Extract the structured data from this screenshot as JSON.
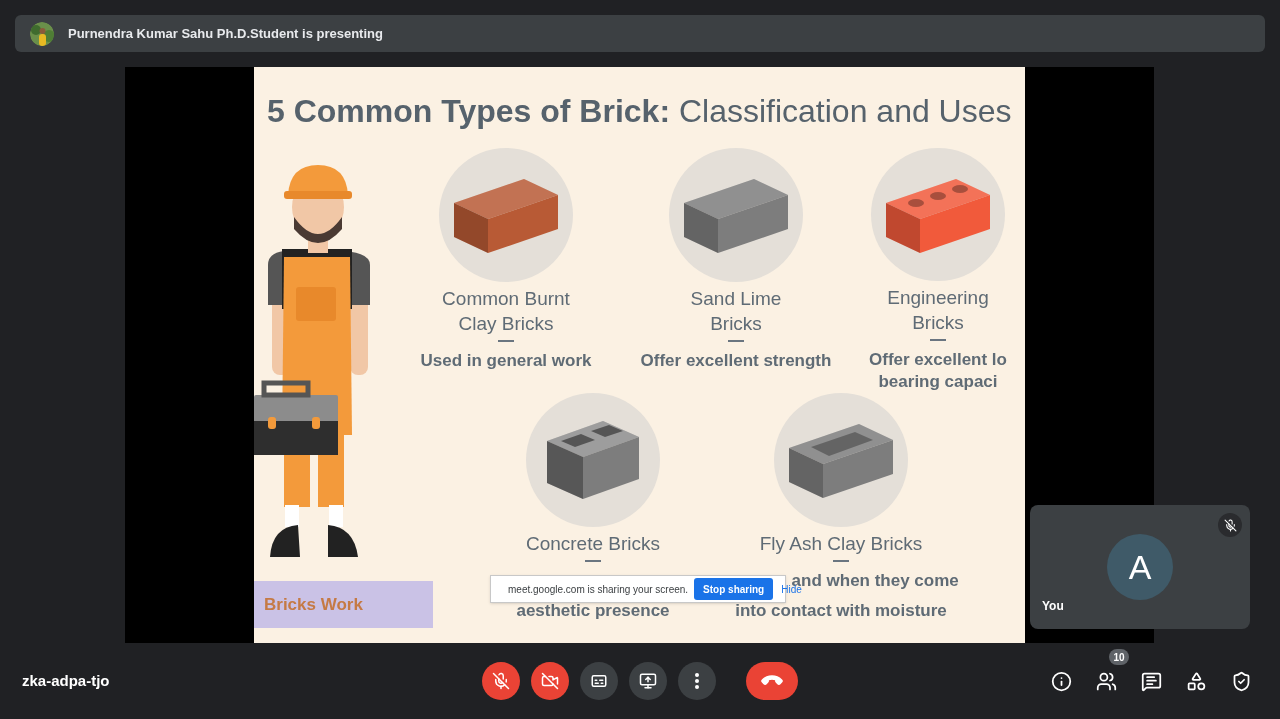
{
  "presenter_bar": {
    "text": "Purnendra Kumar Sahu Ph.D.Student is presenting"
  },
  "slide": {
    "title": "**5 Common Types of Brick:** Classification and Uses",
    "bricks": [
      {
        "kind": "solid",
        "color": "#b85a35",
        "name_lines": [
          "Common Burnt",
          "Clay Bricks"
        ],
        "desc_lines": [
          "Used in general work"
        ]
      },
      {
        "kind": "solid",
        "color": "#7d7d7d",
        "name_lines": [
          "Sand Lime",
          "Bricks"
        ],
        "desc_lines": [
          "Offer excellent strength"
        ]
      },
      {
        "kind": "holes",
        "color": "#f15a3b",
        "name_lines": [
          "Engineering",
          "Bricks"
        ],
        "desc_lines": [
          "Offer excellent lo",
          "bearing capaci"
        ]
      },
      {
        "kind": "hollow",
        "color": "#7d7d7d",
        "name_lines": [
          "Concrete Bricks"
        ],
        "desc_lines": [
          "aesthetic presence"
        ]
      },
      {
        "kind": "frog",
        "color": "#7d7d7d",
        "name_lines": [
          "Fly Ash Clay Bricks"
        ],
        "desc_lines": [
          "and when they come",
          "into contact with moisture"
        ]
      }
    ],
    "label": "Bricks Work"
  },
  "share_popup": {
    "message": "meet.google.com is sharing your screen.",
    "stop": "Stop sharing",
    "hide": "Hide"
  },
  "self_tile": {
    "initial": "A",
    "name": "You",
    "muted": true
  },
  "meeting_code": "zka-adpa-tjo",
  "controls": [
    {
      "kind": "mic",
      "on": false
    },
    {
      "kind": "camera",
      "on": false
    },
    {
      "kind": "captions",
      "on": false
    },
    {
      "kind": "present"
    },
    {
      "kind": "more"
    },
    {
      "kind": "leave"
    }
  ],
  "side_buttons": [
    {
      "kind": "info"
    },
    {
      "kind": "people",
      "badge": "10"
    },
    {
      "kind": "chat"
    },
    {
      "kind": "activities"
    },
    {
      "kind": "host"
    }
  ]
}
